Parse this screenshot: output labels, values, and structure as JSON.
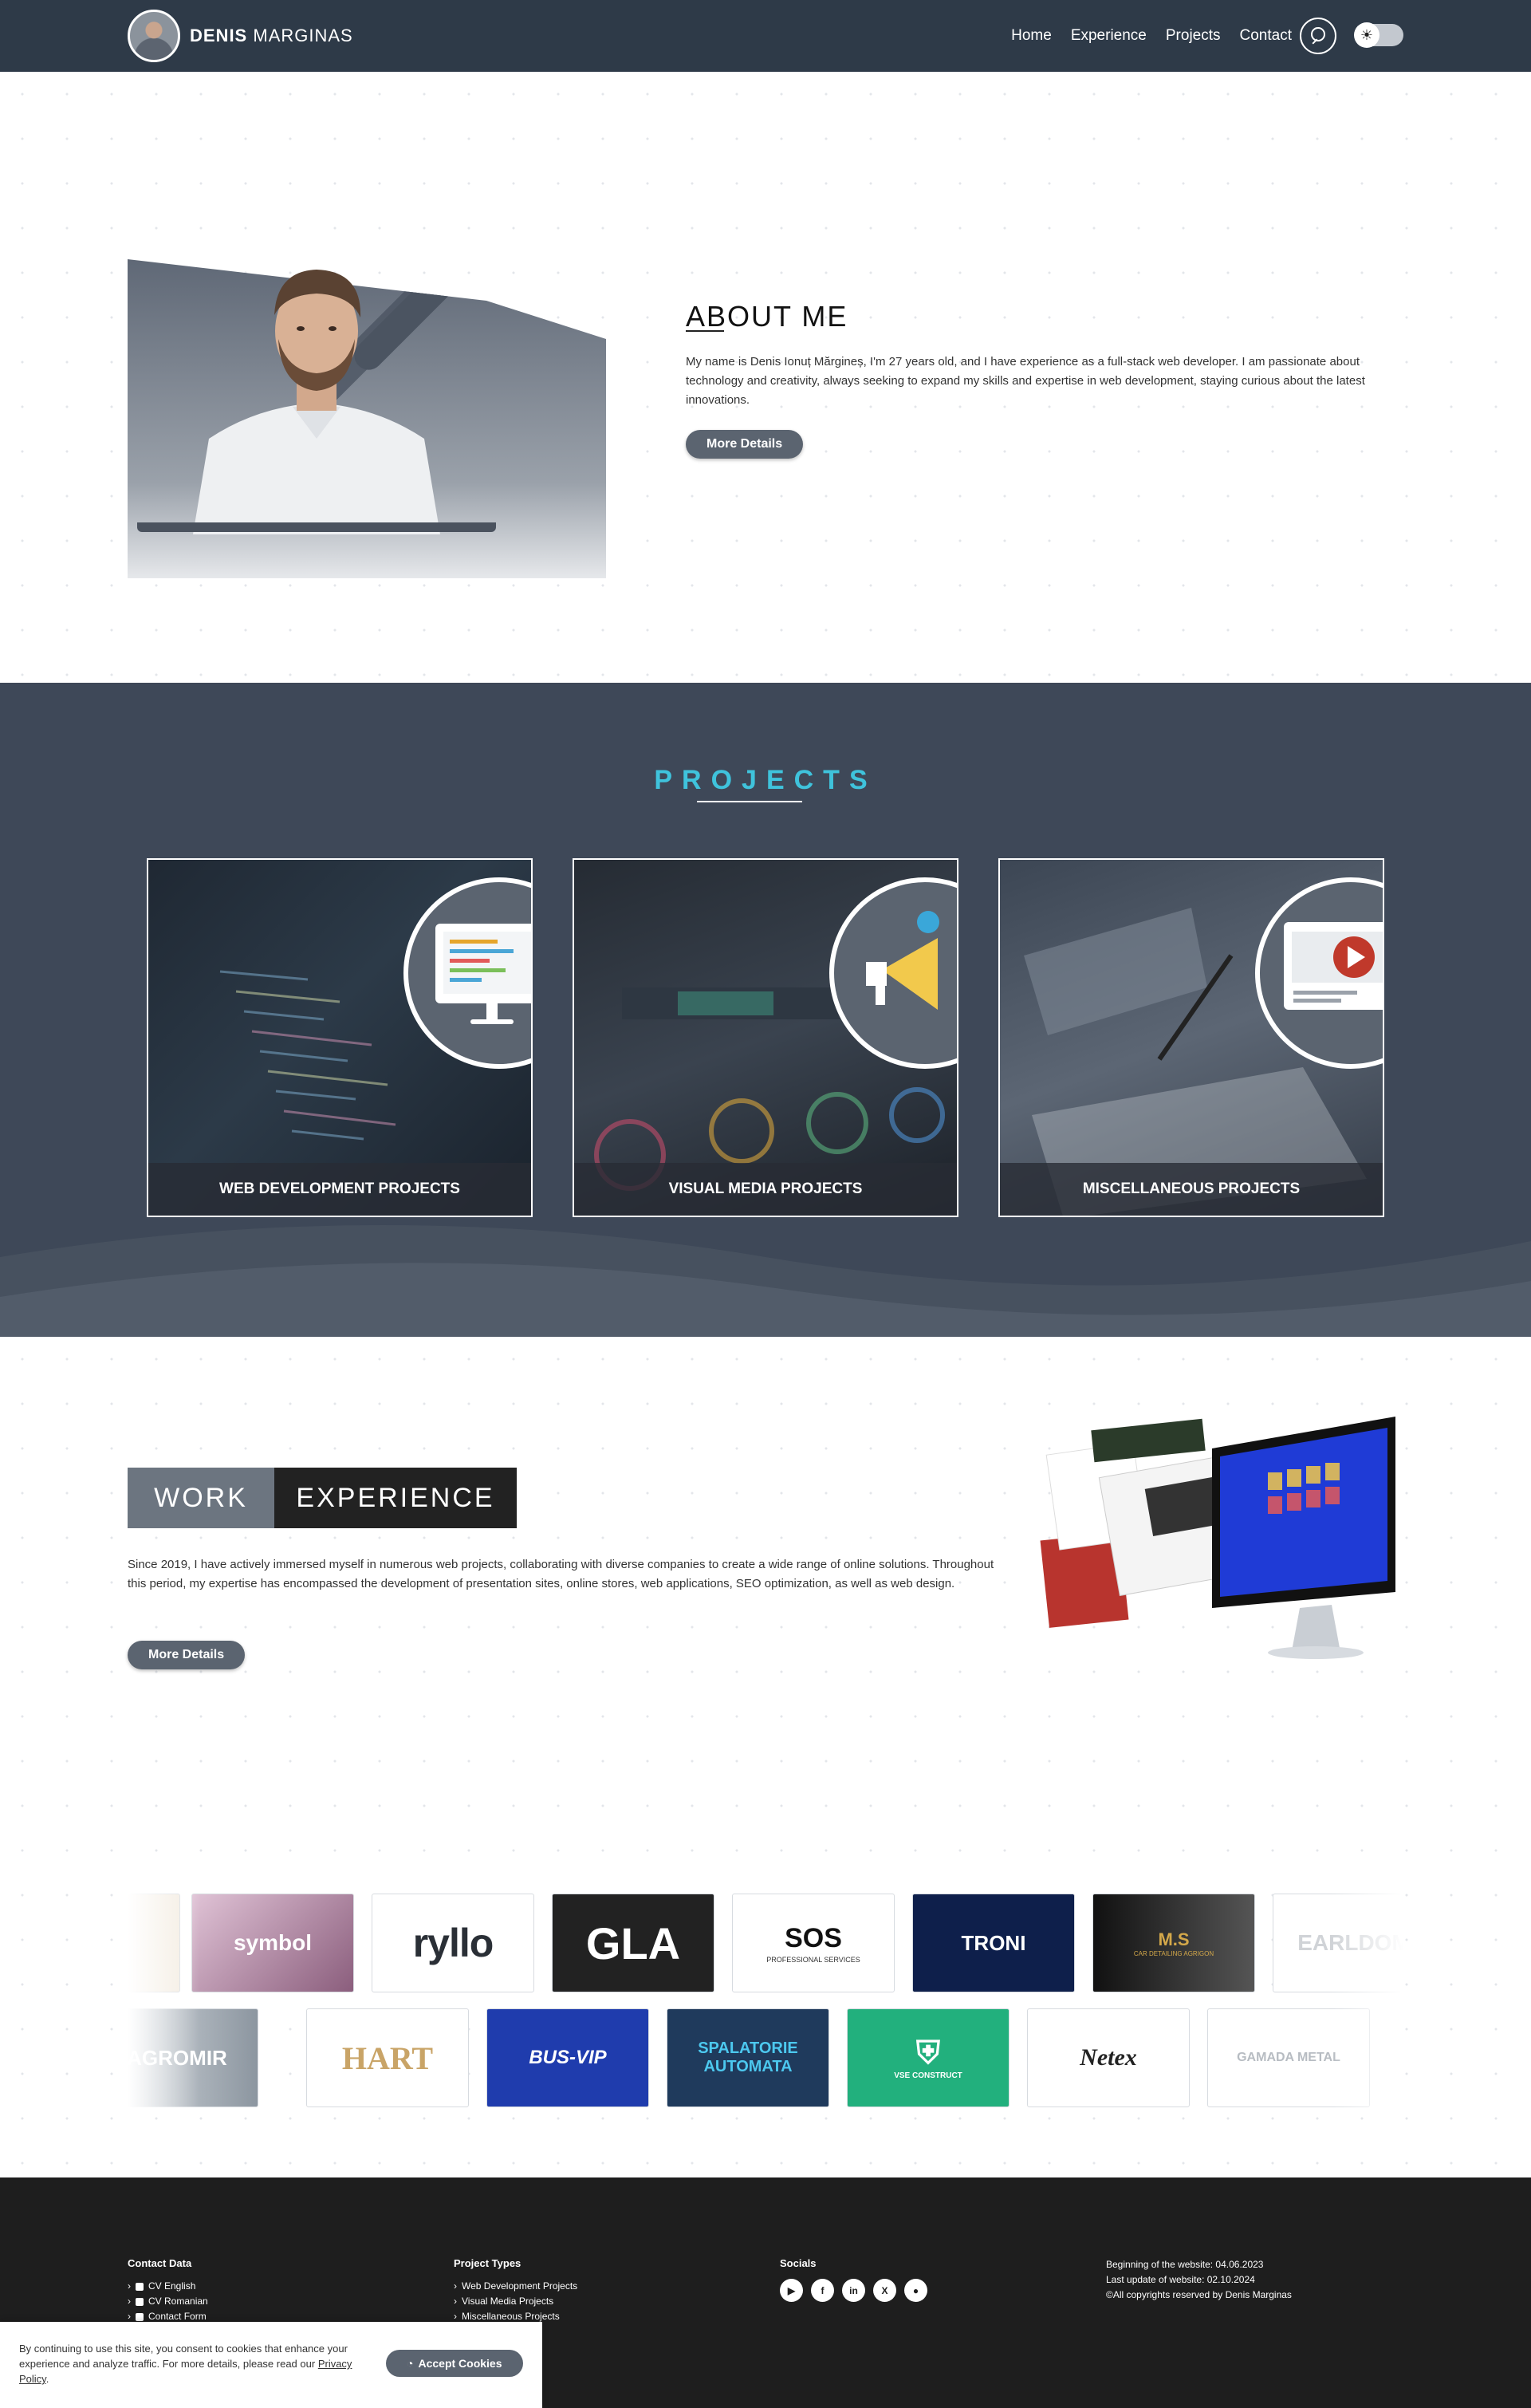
{
  "header": {
    "brand_first": "DENIS",
    "brand_last": "MARGINAS",
    "nav": [
      "Home",
      "Experience",
      "Projects",
      "Contact"
    ]
  },
  "about": {
    "title": "ABOUT ME",
    "text": "My name is Denis Ionuț Mărgineș, I'm 27 years old, and I have experience as a full-stack web developer. I am passionate about technology and creativity, always seeking to expand my skills and expertise in web development, staying curious about the latest innovations.",
    "button": "More Details"
  },
  "projects": {
    "title": "PROJECTS",
    "cards": [
      {
        "label": "WEB DEVELOPMENT PROJECTS"
      },
      {
        "label": "VISUAL MEDIA PROJECTS"
      },
      {
        "label": "MISCELLANEOUS PROJECTS"
      }
    ]
  },
  "work": {
    "badge_left": "WORK",
    "badge_right": "EXPERIENCE",
    "text": "Since 2019, I have actively immersed myself in numerous web projects, collaborating with diverse companies to create a wide range of online solutions. Throughout this period, my expertise has encompassed the development of presentation sites, online stores, web applications, SEO optimization, as well as web design.",
    "button": "More Details"
  },
  "logos_row1": [
    "symbol",
    "ryllo",
    "GLA",
    "SOS",
    "TRONI",
    "M.S",
    "EARLDOM"
  ],
  "logos_row2": [
    "AGROMIR",
    "HART",
    "BUS-VIP",
    "SPALATORIE AUTOMATA",
    "VSE CONSTRUCT",
    "Netex",
    "GAMADA METAL"
  ],
  "logo_subtitles": {
    "sos": "PROFESSIONAL SERVICES",
    "ms": "CAR DETAILING AGRIGON",
    "vse": "VSE CONSTRUCT"
  },
  "footer": {
    "contact": {
      "title": "Contact Data",
      "items": [
        "CV English",
        "CV Romanian",
        "Contact Form"
      ]
    },
    "projects": {
      "title": "Project Types",
      "items": [
        "Web Development Projects",
        "Visual Media Projects",
        "Miscellaneous Projects"
      ]
    },
    "socials": {
      "title": "Socials",
      "icons": [
        "youtube-icon",
        "facebook-icon",
        "linkedin-icon",
        "x-icon",
        "github-icon"
      ]
    },
    "info": [
      "Beginning of the website: 04.06.2023",
      "Last update of website: 02.10.2024",
      "©All copyrights reserved by Denis Marginas"
    ]
  },
  "cookie": {
    "text": "By continuing to use this site, you consent to cookies that enhance your experience and analyze traffic. For more details, please read our",
    "link": "Privacy Policy",
    "button": "Accept Cookies"
  }
}
